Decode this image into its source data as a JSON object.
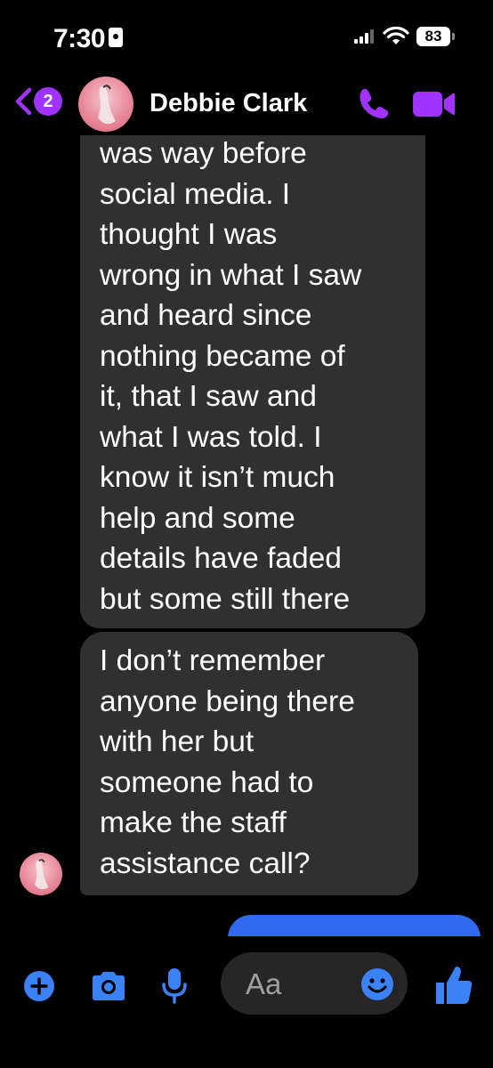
{
  "status_bar": {
    "time": "7:30",
    "battery_percent": "83"
  },
  "header": {
    "unread_count": "2",
    "contact_name": "Debbie Clark"
  },
  "messages": [
    {
      "direction": "incoming",
      "text": "was way before\nsocial media. I\nthought I was\nwrong in what I saw\nand heard since\nnothing became of\nit, that I saw and\nwhat I was told. I\nknow it isn’t much\nhelp and some\ndetails have faded\nbut some still there"
    },
    {
      "direction": "incoming",
      "text": "I don’t remember\nanyone being there\nwith her but\nsomeone had to\nmake the staff\nassistance call?"
    }
  ],
  "composer": {
    "placeholder": "Aa"
  },
  "colors": {
    "accent_purple": "#a033ff",
    "incoming_bubble": "#303030",
    "outgoing_bubble": "#2f6bf1",
    "toolbar_blue": "#3b82f6"
  }
}
